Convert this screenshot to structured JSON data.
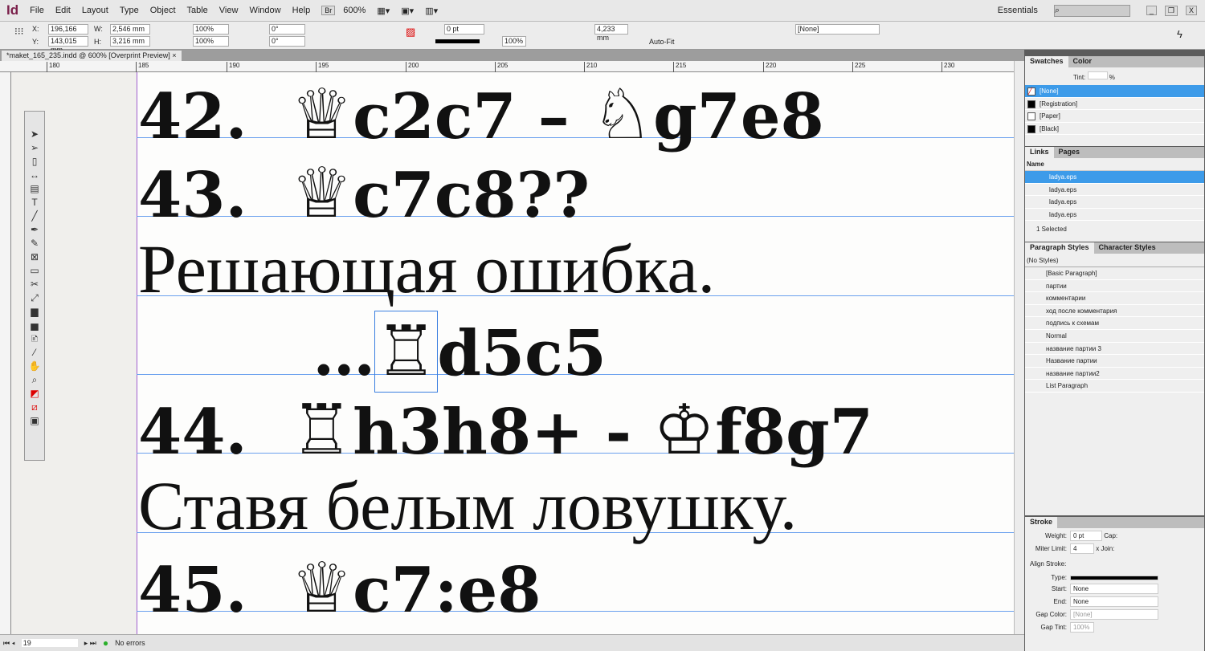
{
  "app": {
    "logo": "Id",
    "menu": [
      "File",
      "Edit",
      "Layout",
      "Type",
      "Object",
      "Table",
      "View",
      "Window",
      "Help"
    ],
    "bridge": "Br",
    "zoom": "600%",
    "workspace": "Essentials",
    "window_controls": [
      "_",
      "❐",
      "X"
    ]
  },
  "control": {
    "x": "196,166 mm",
    "y": "143,015 mm",
    "w": "2,546 mm",
    "h": "3,216 mm",
    "scale_x": "100%",
    "scale_y": "100%",
    "angle": "0°",
    "shear": "0°",
    "stroke_weight": "0 pt",
    "opacity": "100%",
    "offset": "4,233 mm",
    "autofit": "Auto-Fit",
    "object_style": "[None]",
    "labels": {
      "x": "X:",
      "y": "Y:",
      "w": "W:",
      "h": "H:"
    }
  },
  "document": {
    "tab": "*maket_165_235.indd @ 600% [Overprint Preview]",
    "ruler": [
      "180",
      "185",
      "190",
      "195",
      "200",
      "205",
      "210",
      "215",
      "220",
      "225",
      "230"
    ],
    "lines": [
      {
        "parts": [
          "42.  ",
          "♕",
          "c2c7 – ",
          "♘",
          "g7e8"
        ]
      },
      {
        "parts": [
          "43.  ",
          "♕",
          "c7c8??"
        ]
      },
      {
        "text": "Решающая ошибка."
      },
      {
        "parts": [
          "        …",
          "♖",
          "d5c5"
        ]
      },
      {
        "parts": [
          "44.  ",
          "♖",
          "h3h8+ - ",
          "♔",
          "f8g7"
        ]
      },
      {
        "text": "Ставя белым ловушку."
      },
      {
        "parts": [
          "45.  ",
          "♕",
          "c7:e8"
        ]
      }
    ]
  },
  "status": {
    "page": "19",
    "preflight": "No errors"
  },
  "swatches": {
    "tabs": [
      "Swatches",
      "Color"
    ],
    "tint_label": "Tint:",
    "tint_unit": "%",
    "items": [
      "[None]",
      "[Registration]",
      "[Paper]",
      "[Black]"
    ],
    "colors": [
      "none",
      "#000000",
      "#ffffff",
      "#000000"
    ]
  },
  "links": {
    "tabs": [
      "Links",
      "Pages"
    ],
    "name_header": "Name",
    "items": [
      "ladya.eps",
      "ladya.eps",
      "ladya.eps",
      "ladya.eps"
    ],
    "selected": "1 Selected"
  },
  "paragraph_styles": {
    "tabs": [
      "Paragraph Styles",
      "Character Styles"
    ],
    "current": "(No Styles)",
    "items": [
      "[Basic Paragraph]",
      "партии",
      "комментарии",
      "ход после комментария",
      "подпись к схемам",
      "Normal",
      "название партии 3",
      "Название партии",
      "название партии2",
      "List Paragraph"
    ]
  },
  "stroke": {
    "title": "Stroke",
    "weight_label": "Weight:",
    "weight": "0 pt",
    "cap_label": "Cap:",
    "miter_label": "Miter Limit:",
    "miter": "4",
    "miter_unit": "x",
    "join_label": "Join:",
    "align_label": "Align Stroke:",
    "type_label": "Type:",
    "start_label": "Start:",
    "start": "None",
    "end_label": "End:",
    "end": "None",
    "gap_color_label": "Gap Color:",
    "gap_color": "[None]",
    "gap_tint_label": "Gap Tint:",
    "gap_tint": "100%"
  }
}
